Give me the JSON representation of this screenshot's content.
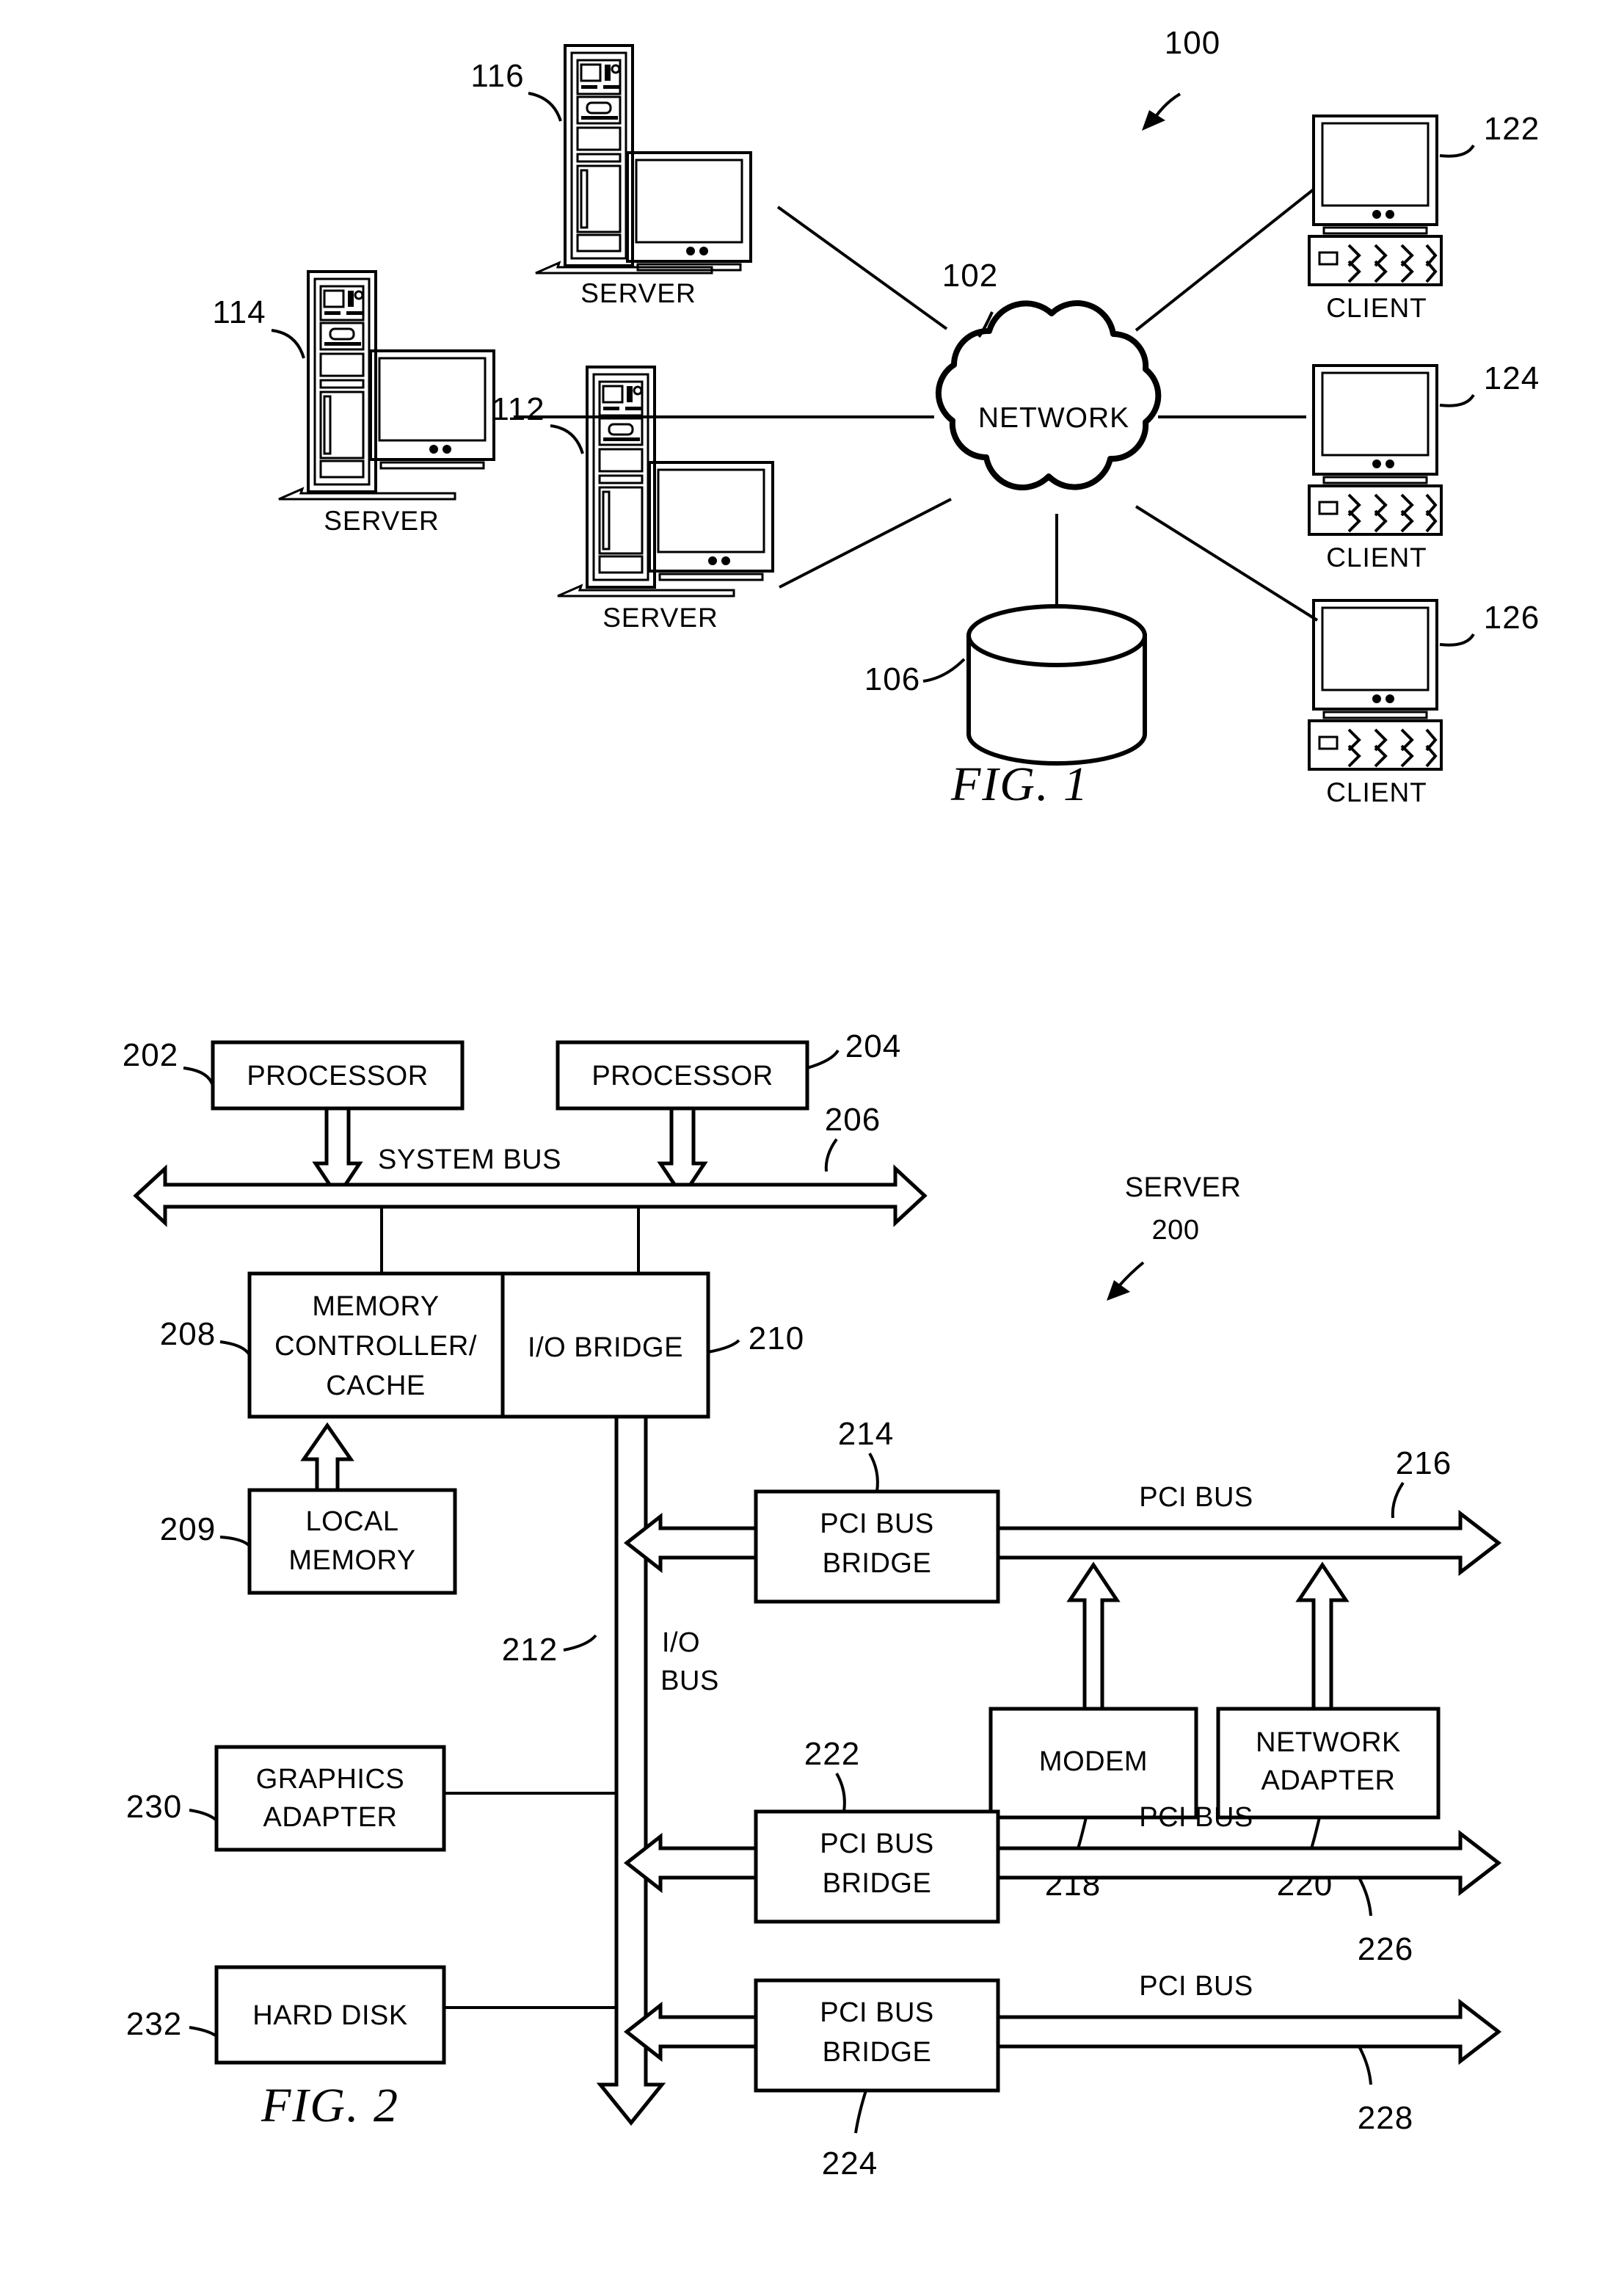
{
  "figure1": {
    "caption": "FIG. 1",
    "system_ref": "100",
    "network": {
      "label": "NETWORK",
      "ref": "102"
    },
    "storage": {
      "ref": "106"
    },
    "servers": [
      {
        "ref": "116",
        "label": "SERVER"
      },
      {
        "ref": "114",
        "label": "SERVER"
      },
      {
        "ref": "112",
        "label": "SERVER"
      }
    ],
    "clients": [
      {
        "ref": "122",
        "label": "CLIENT"
      },
      {
        "ref": "124",
        "label": "CLIENT"
      },
      {
        "ref": "126",
        "label": "CLIENT"
      }
    ]
  },
  "figure2": {
    "caption": "FIG. 2",
    "system_title": "SERVER",
    "system_ref": "200",
    "blocks": [
      {
        "id": "processor1",
        "label": "PROCESSOR",
        "ref": "202"
      },
      {
        "id": "processor2",
        "label": "PROCESSOR",
        "ref": "204"
      },
      {
        "id": "memory-controller-cache",
        "label_line1": "MEMORY",
        "label_line2": "CONTROLLER/",
        "label_line3": "CACHE",
        "ref": "208"
      },
      {
        "id": "io-bridge",
        "label": "I/O BRIDGE",
        "ref": "210"
      },
      {
        "id": "local-memory",
        "label_line1": "LOCAL",
        "label_line2": "MEMORY",
        "ref": "209"
      },
      {
        "id": "pci-bus-bridge-1",
        "label_line1": "PCI BUS",
        "label_line2": "BRIDGE",
        "ref": "214"
      },
      {
        "id": "modem",
        "label": "MODEM",
        "ref": "218"
      },
      {
        "id": "network-adapter",
        "label_line1": "NETWORK",
        "label_line2": "ADAPTER",
        "ref": "220"
      },
      {
        "id": "pci-bus-bridge-2",
        "label_line1": "PCI BUS",
        "label_line2": "BRIDGE",
        "ref": "222"
      },
      {
        "id": "pci-bus-bridge-3",
        "label_line1": "PCI BUS",
        "label_line2": "BRIDGE",
        "ref": "224"
      },
      {
        "id": "graphics-adapter",
        "label_line1": "GRAPHICS",
        "label_line2": "ADAPTER",
        "ref": "230"
      },
      {
        "id": "hard-disk",
        "label": "HARD DISK",
        "ref": "232"
      }
    ],
    "buses": [
      {
        "id": "system-bus",
        "label": "SYSTEM BUS",
        "ref": "206"
      },
      {
        "id": "io-bus",
        "label_line1": "I/O",
        "label_line2": "BUS",
        "ref": "212"
      },
      {
        "id": "pci-bus-1",
        "label": "PCI BUS",
        "ref": "216"
      },
      {
        "id": "pci-bus-2",
        "label": "PCI BUS",
        "ref": "226"
      },
      {
        "id": "pci-bus-3",
        "label": "PCI BUS",
        "ref": "228"
      }
    ]
  },
  "colors": {
    "ink": "#000000",
    "paper": "#ffffff"
  }
}
